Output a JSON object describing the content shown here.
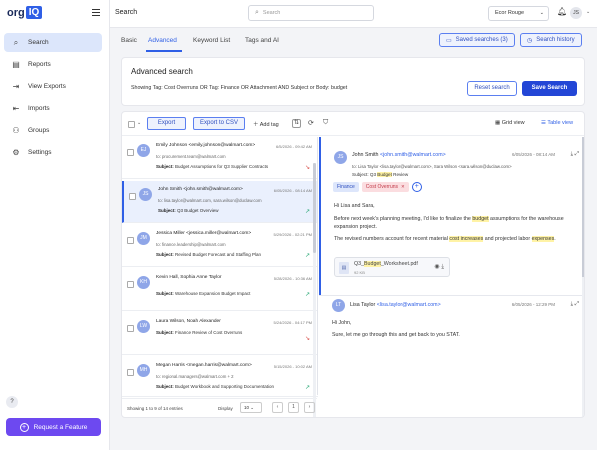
{
  "app": {
    "logo_org": "org",
    "logo_iq": "IQ",
    "page_title": "Search"
  },
  "colors": {
    "accent": "#2f5fe6",
    "primary_button": "#2346d6",
    "feature_button": "#6d49f0",
    "highlight": "#fff3a6",
    "trend_down": "#d9534f",
    "trend_up": "#2aa876"
  },
  "sidebar": {
    "items": [
      {
        "label": "Search",
        "icon": "search-icon",
        "glyph": "⌕"
      },
      {
        "label": "Reports",
        "icon": "reports-icon",
        "glyph": "▤"
      },
      {
        "label": "View Exports",
        "icon": "exports-icon",
        "glyph": "⇥"
      },
      {
        "label": "Imports",
        "icon": "imports-icon",
        "glyph": "⇤"
      },
      {
        "label": "Groups",
        "icon": "groups-icon",
        "glyph": "⚇"
      },
      {
        "label": "Settings",
        "icon": "gear-icon",
        "glyph": "⚙"
      }
    ],
    "help": "?",
    "feature_button": "Request a Feature"
  },
  "topbar": {
    "search_placeholder": "Search",
    "user_select": "Ecor Rouge",
    "avatar": "JS"
  },
  "tabs": [
    "Basic",
    "Advanced",
    "Keyword List",
    "Tags and AI"
  ],
  "saved_searches": "Saved searches (3)",
  "search_history": "Search history",
  "advanced": {
    "title": "Advanced search",
    "query": "Showing Tag: Cost Overruns OR Tag: Finance OR Attachment AND Subject or Body: budget",
    "reset": "Reset search",
    "search": "Save Search"
  },
  "toolbar": {
    "export": "Export",
    "csv": "Export to CSV",
    "add_tag": "Add tag",
    "grid_view": "Grid view",
    "table_view": "Table view"
  },
  "emails": [
    {
      "initials": "EJ",
      "from": "Emily Johnson <emily.johnson@walmart.com>",
      "date": "6/5/2026 - 09:42 AM",
      "to": "to: procurement.team@walmart.com",
      "subject_label": "Subject:",
      "subject": "Budget Assumptions for Q3 Supplier Contracts",
      "trend": "down"
    },
    {
      "initials": "JS",
      "from": "John Smith <john.smith@walmart.com>",
      "date": "6/05/2026 - 08:14 AM",
      "to": "to: lisa.taylor@walmart.com, sara.wilson@duclaw.com",
      "subject_label": "Subject:",
      "subject": "Q3 Budget Overview",
      "trend": "up",
      "selected": true
    },
    {
      "initials": "JM",
      "from": "Jessica Miller <jessica.miller@walmart.com>",
      "date": "5/29/2026 - 02:21 PM",
      "to": "to: finance.leadership@walmart.com",
      "subject_label": "Subject:",
      "subject": "Revised Budget Forecast and Staffing Plan",
      "trend": "up"
    },
    {
      "initials": "KH",
      "from": "Kevin Hall, Sophia Anne Taylor",
      "date": "5/28/2026 - 10:36 AM",
      "to": "",
      "subject_label": "Subject:",
      "subject": "Warehouse Expansion Budget Impact",
      "trend": "up"
    },
    {
      "initials": "LW",
      "from": "Laura Wilson, Noah Alexander",
      "date": "5/24/2026 - 04:17 PM",
      "to": "",
      "subject_label": "Subject:",
      "subject": "Finance Review of Cost Overruns",
      "trend": "down"
    },
    {
      "initials": "MH",
      "from": "Megan Harris <megan.harris@walmart.com>",
      "date": "5/15/2026 - 10:02 AM",
      "to": "to: regional.managers@walmart.com + 2",
      "subject_label": "Subject:",
      "subject": "Budget Workbook and Supporting Documentation",
      "trend": "up"
    }
  ],
  "footer": {
    "info": "Showing 1 to 9 of 14 entries",
    "display_label": "Display",
    "display_value": "10",
    "page": "1",
    "prev": "‹",
    "next": "›"
  },
  "detail": {
    "initials": "JS",
    "from_name": "John Smith",
    "from_email": "<john.smith@walmart.com>",
    "date": "6/05/2026 - 08:14 AM",
    "to": "to: Lisa Taylor <lisa.taylor@walmart.com>, Sara Wilson <sara.wilson@duclaw.com>",
    "subject_prefix": "Subject: Q3 ",
    "subject_hl": "Budget",
    "subject_suffix": " Review",
    "tags": [
      "Finance",
      "Cost Overruns"
    ],
    "greeting": "Hi Lisa and Sara,",
    "p1_a": "Before next week's planning meeting, I'd like to finalize the ",
    "p1_hl": "budget",
    "p1_b": " assumptions for the warehouse expansion project.",
    "p2_a": "The revised numbers account for recent material ",
    "p2_hl": "cost increases",
    "p2_b": " and projected labor ",
    "p2_hl2": "expenses",
    "p2_c": ".",
    "attachment_a": "Q3_",
    "attachment_hl": "Budget",
    "attachment_b": "_Worksheet.pdf",
    "attachment_size": "92 KB",
    "reply": {
      "initials": "LT",
      "from_name": "Lisa Taylor",
      "from_email": "<lisa.taylor@walmart.com>",
      "date": "6/05/2026 - 12:29 PM",
      "greeting": "Hi John,",
      "body": "Sure, let me go through this and get back to you STAT."
    }
  }
}
